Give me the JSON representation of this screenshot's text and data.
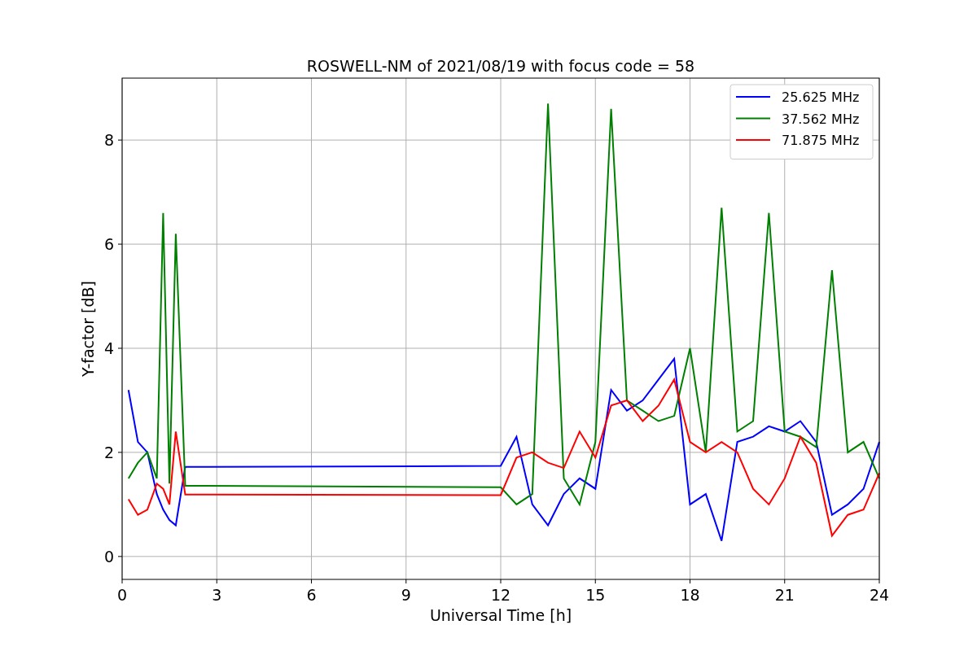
{
  "figure": {
    "chart_data": {
      "type": "line",
      "title": "ROSWELL-NM of 2021/08/19 with focus code = 58",
      "xlabel": "Universal Time [h]",
      "ylabel": "Y-factor [dB]",
      "x": [
        0.2,
        0.5,
        0.8,
        1.1,
        1.3,
        1.5,
        1.7,
        2.0,
        12.0,
        12.5,
        13.0,
        13.5,
        14.0,
        14.5,
        15.0,
        15.5,
        16.0,
        16.5,
        17.0,
        17.5,
        18.0,
        18.5,
        19.0,
        19.5,
        20.0,
        20.5,
        21.0,
        21.5,
        22.0,
        22.5,
        23.0,
        23.5,
        24.0
      ],
      "series": [
        {
          "name": "25.625 MHz",
          "color": "#0000ff",
          "values": [
            3.2,
            2.2,
            2.0,
            1.2,
            0.9,
            0.7,
            0.6,
            1.72,
            1.74,
            2.3,
            1.0,
            0.6,
            1.2,
            1.5,
            1.3,
            3.2,
            2.8,
            3.0,
            3.4,
            3.8,
            1.0,
            1.2,
            0.3,
            2.2,
            2.3,
            2.5,
            2.4,
            2.6,
            2.2,
            0.8,
            1.0,
            1.3,
            2.2
          ]
        },
        {
          "name": "37.562 MHz",
          "color": "#008000",
          "values": [
            1.5,
            1.8,
            2.0,
            1.5,
            6.6,
            1.4,
            6.2,
            1.36,
            1.33,
            1.0,
            1.2,
            8.7,
            1.5,
            1.0,
            2.2,
            8.6,
            3.0,
            2.8,
            2.6,
            2.7,
            4.0,
            2.0,
            6.7,
            2.4,
            2.6,
            6.6,
            2.4,
            2.3,
            2.1,
            5.5,
            2.0,
            2.2,
            1.5
          ]
        },
        {
          "name": "71.875 MHz",
          "color": "#ff0000",
          "values": [
            1.1,
            0.8,
            0.9,
            1.4,
            1.3,
            1.0,
            2.4,
            1.19,
            1.18,
            1.9,
            2.0,
            1.8,
            1.7,
            2.4,
            1.9,
            2.9,
            3.0,
            2.6,
            2.9,
            3.4,
            2.2,
            2.0,
            2.2,
            2.0,
            1.3,
            1.0,
            1.5,
            2.3,
            1.8,
            0.4,
            0.8,
            0.9,
            1.6
          ]
        }
      ],
      "xlim": [
        0,
        24
      ],
      "ylim": [
        -0.44,
        9.19
      ],
      "xticks": [
        0,
        3,
        6,
        9,
        12,
        15,
        18,
        21,
        24
      ],
      "yticks": [
        0,
        2,
        4,
        6,
        8
      ],
      "grid": true,
      "legend": true
    }
  }
}
